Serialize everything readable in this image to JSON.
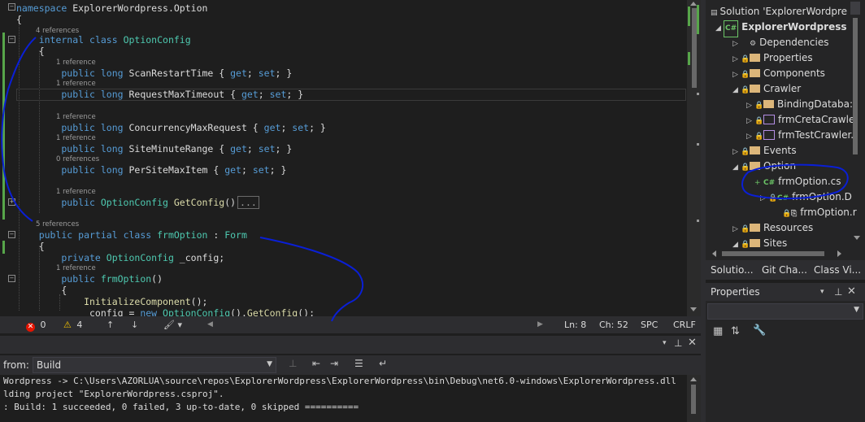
{
  "editor": {
    "code_lines": [
      {
        "parts": [
          {
            "t": "namespace ",
            "c": "kw"
          },
          {
            "t": "ExplorerWordpress.Option",
            "c": ""
          }
        ]
      },
      {
        "parts": [
          {
            "t": "{",
            "c": ""
          }
        ]
      },
      {
        "parts": [
          {
            "t": "    internal ",
            "c": "kw"
          },
          {
            "t": "class ",
            "c": "kw"
          },
          {
            "t": "OptionConfig",
            "c": "ty"
          }
        ]
      },
      {
        "parts": [
          {
            "t": "    {",
            "c": ""
          }
        ]
      },
      {
        "parts": [
          {
            "t": "        public ",
            "c": "kw"
          },
          {
            "t": "long ",
            "c": "kw"
          },
          {
            "t": "ScanRestartTime { ",
            "c": ""
          },
          {
            "t": "get",
            "c": "kw"
          },
          {
            "t": "; ",
            "c": ""
          },
          {
            "t": "set",
            "c": "kw"
          },
          {
            "t": "; }",
            "c": ""
          }
        ]
      },
      {
        "parts": [
          {
            "t": "        public ",
            "c": "kw"
          },
          {
            "t": "long ",
            "c": "kw"
          },
          {
            "t": "RequestMaxTimeout { ",
            "c": ""
          },
          {
            "t": "get",
            "c": "kw"
          },
          {
            "t": "; ",
            "c": ""
          },
          {
            "t": "set",
            "c": "kw"
          },
          {
            "t": "; }",
            "c": ""
          }
        ]
      },
      {
        "parts": [
          {
            "t": "        public ",
            "c": "kw"
          },
          {
            "t": "long ",
            "c": "kw"
          },
          {
            "t": "ConcurrencyMaxRequest { ",
            "c": ""
          },
          {
            "t": "get",
            "c": "kw"
          },
          {
            "t": "; ",
            "c": ""
          },
          {
            "t": "set",
            "c": "kw"
          },
          {
            "t": "; }",
            "c": ""
          }
        ]
      },
      {
        "parts": [
          {
            "t": "        public ",
            "c": "kw"
          },
          {
            "t": "long ",
            "c": "kw"
          },
          {
            "t": "SiteMinuteRange { ",
            "c": ""
          },
          {
            "t": "get",
            "c": "kw"
          },
          {
            "t": "; ",
            "c": ""
          },
          {
            "t": "set",
            "c": "kw"
          },
          {
            "t": "; }",
            "c": ""
          }
        ]
      },
      {
        "parts": [
          {
            "t": "        public ",
            "c": "kw"
          },
          {
            "t": "long ",
            "c": "kw"
          },
          {
            "t": "PerSiteMaxItem { ",
            "c": ""
          },
          {
            "t": "get",
            "c": "kw"
          },
          {
            "t": "; ",
            "c": ""
          },
          {
            "t": "set",
            "c": "kw"
          },
          {
            "t": "; }",
            "c": ""
          }
        ]
      },
      {
        "parts": [
          {
            "t": "        public ",
            "c": "kw"
          },
          {
            "t": "OptionConfig ",
            "c": "ty"
          },
          {
            "t": "GetConfig",
            "c": "fn"
          },
          {
            "t": "()",
            "c": ""
          },
          {
            "t": "...",
            "c": "box"
          }
        ]
      },
      {
        "parts": [
          {
            "t": "    public ",
            "c": "kw"
          },
          {
            "t": "partial ",
            "c": "kw"
          },
          {
            "t": "class ",
            "c": "kw"
          },
          {
            "t": "frmOption",
            "c": "ty"
          },
          {
            "t": " : ",
            "c": ""
          },
          {
            "t": "Form",
            "c": "ty"
          }
        ]
      },
      {
        "parts": [
          {
            "t": "    {",
            "c": ""
          }
        ]
      },
      {
        "parts": [
          {
            "t": "        private ",
            "c": "kw"
          },
          {
            "t": "OptionConfig ",
            "c": "ty"
          },
          {
            "t": "_config;",
            "c": ""
          }
        ]
      },
      {
        "parts": [
          {
            "t": "        public ",
            "c": "kw"
          },
          {
            "t": "frmOption",
            "c": "ty"
          },
          {
            "t": "()",
            "c": ""
          }
        ]
      },
      {
        "parts": [
          {
            "t": "        {",
            "c": ""
          }
        ]
      },
      {
        "parts": [
          {
            "t": "            InitializeComponent",
            "c": "fn"
          },
          {
            "t": "();",
            "c": ""
          }
        ]
      },
      {
        "parts": [
          {
            "t": "            _config = ",
            "c": ""
          },
          {
            "t": "new ",
            "c": "kw"
          },
          {
            "t": "OptionConfig",
            "c": "ty"
          },
          {
            "t": "().",
            "c": ""
          },
          {
            "t": "GetConfig",
            "c": "fn"
          },
          {
            "t": "();",
            "c": ""
          }
        ]
      }
    ],
    "lenses": [
      "4 references",
      "1 reference",
      "1 reference",
      "1 reference",
      "1 reference",
      "0 references",
      "1 reference",
      "5 references",
      "1 reference"
    ]
  },
  "status": {
    "errors": "0",
    "warnings": "4",
    "line": "Ln: 8",
    "col": "Ch: 52",
    "spc": "SPC",
    "crlf": "CRLF"
  },
  "output": {
    "from_label": "from:",
    "source": "Build",
    "lines": [
      "Wordpress -> C:\\Users\\AZORLUA\\source\\repos\\ExplorerWordpress\\ExplorerWordpress\\bin\\Debug\\net6.0-windows\\ExplorerWordpress.dll",
      "lding project \"ExplorerWordpress.csproj\".",
      ": Build: 1 succeeded, 0 failed, 3 up-to-date, 0 skipped =========="
    ]
  },
  "solution": {
    "solution_label": "Solution 'ExplorerWordpre",
    "project": "ExplorerWordpress",
    "items": [
      {
        "label": "Dependencies",
        "kind": "deps"
      },
      {
        "label": "Properties",
        "kind": "folder"
      },
      {
        "label": "Components",
        "kind": "folder"
      },
      {
        "label": "Crawler",
        "kind": "folder"
      },
      {
        "label": "BindingDataba:",
        "kind": "folder"
      },
      {
        "label": "frmCretaCrawle",
        "kind": "form"
      },
      {
        "label": "frmTestCrawler.",
        "kind": "form"
      },
      {
        "label": "Events",
        "kind": "folder"
      },
      {
        "label": "Option",
        "kind": "folder"
      },
      {
        "label": "frmOption.cs",
        "kind": "cs"
      },
      {
        "label": "frmOption.D",
        "kind": "cs"
      },
      {
        "label": "frmOption.r",
        "kind": "res"
      },
      {
        "label": "Resources",
        "kind": "folder"
      },
      {
        "label": "Sites",
        "kind": "folder"
      }
    ],
    "tabs": [
      "Solutio...",
      "Git Cha...",
      "Class Vi..."
    ]
  },
  "properties": {
    "title": "Properties"
  },
  "colors": {
    "annotation": "#0a1fd6",
    "accent": "#007acc"
  }
}
